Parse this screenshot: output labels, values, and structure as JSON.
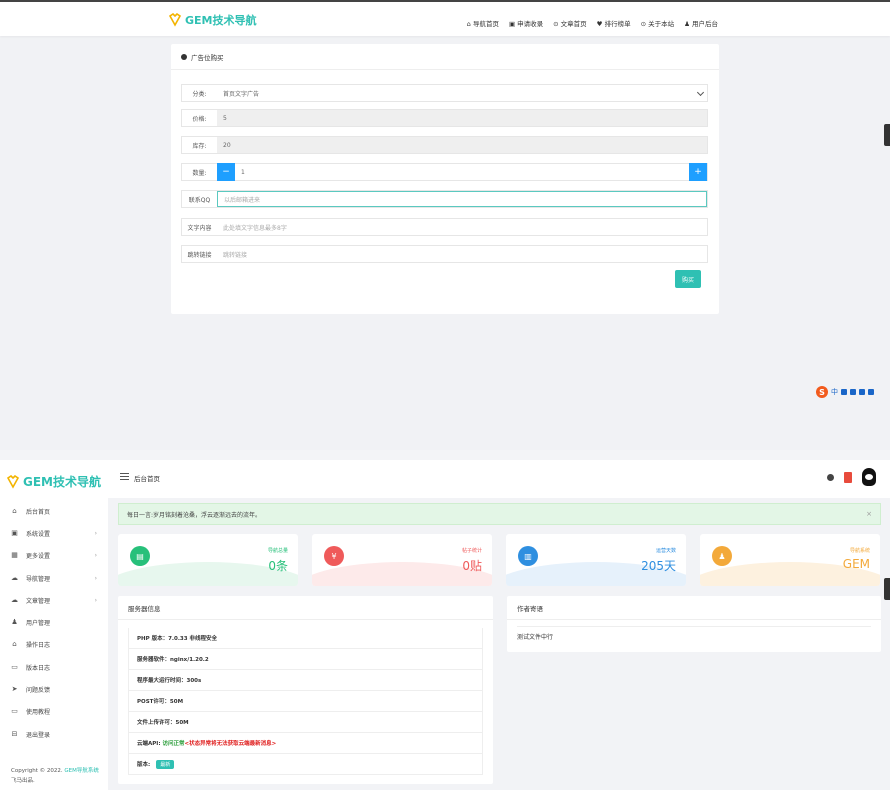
{
  "brand": {
    "name": "GEM技术导航",
    "accent": "#2fc0b3"
  },
  "top_nav": {
    "items": [
      {
        "icon": "home-icon",
        "label": "导航首页"
      },
      {
        "icon": "apply-icon",
        "label": "申请收录"
      },
      {
        "icon": "article-icon",
        "label": "文章首页"
      },
      {
        "icon": "rank-icon",
        "label": "排行榜单"
      },
      {
        "icon": "about-icon",
        "label": "关于本站"
      },
      {
        "icon": "user-icon",
        "label": "用户后台"
      }
    ]
  },
  "ad_form": {
    "title": "广告位购买",
    "category_label": "分类:",
    "category_value": "首页文字广告",
    "price_label": "价格:",
    "price_value": "5",
    "stock_label": "库存:",
    "stock_value": "20",
    "qty_label": "数量:",
    "qty_value": "1",
    "qty_minus": "−",
    "qty_plus": "+",
    "qq_label": "联系QQ",
    "qq_placeholder": "以后邮箱进来",
    "text_label": "文字内容",
    "text_placeholder": "此处填文字信息最多8字",
    "link_label": "跳转链接",
    "link_placeholder": "跳转链接",
    "buy_button": "购买"
  },
  "ime": {
    "logo": "S",
    "mode": "中"
  },
  "admin": {
    "header_title": "后台首页",
    "menu": [
      {
        "icon": "home-icon",
        "glyph": "⌂",
        "label": "后台首页",
        "arrow": ""
      },
      {
        "icon": "settings-icon",
        "glyph": "▣",
        "label": "系统设置",
        "arrow": "›"
      },
      {
        "icon": "grid-icon",
        "glyph": "▦",
        "label": "更多设置",
        "arrow": "›"
      },
      {
        "icon": "nav-icon",
        "glyph": "☁",
        "label": "导航管理",
        "arrow": "›"
      },
      {
        "icon": "cloud-icon",
        "glyph": "☁",
        "label": "文章管理",
        "arrow": "›"
      },
      {
        "icon": "user-icon",
        "glyph": "♟",
        "label": "用户管理",
        "arrow": ""
      },
      {
        "icon": "log-icon",
        "glyph": "⌂",
        "label": "操作日志",
        "arrow": ""
      },
      {
        "icon": "chat-icon",
        "glyph": "▭",
        "label": "版本日志",
        "arrow": ""
      },
      {
        "icon": "send-icon",
        "glyph": "➤",
        "label": "问题反馈",
        "arrow": ""
      },
      {
        "icon": "tutorial-icon",
        "glyph": "▭",
        "label": "使用教程",
        "arrow": ""
      },
      {
        "icon": "logout-icon",
        "glyph": "⊟",
        "label": "退出登录",
        "arrow": ""
      }
    ],
    "copyright_prefix": "Copyright © 2022.",
    "copyright_link": "GEM导航系统",
    "copyright_suffix": "飞马出品.",
    "notice": "每日一言:岁月铭刻着沧桑，浮云逐渐远去的流年。",
    "stats": [
      {
        "icon": "list-icon",
        "glyph": "▤",
        "label": "导航总量",
        "value": "0条",
        "color": "#27c07a",
        "bg": "#e7f7ee"
      },
      {
        "icon": "yen-icon",
        "glyph": "¥",
        "label": "帖子统计",
        "value": "0贴",
        "color": "#ef5a5a",
        "bg": "#fdeaea"
      },
      {
        "icon": "chart-icon",
        "glyph": "▥",
        "label": "运营天数",
        "value": "205天",
        "color": "#2f8fe0",
        "bg": "#e6f1fb"
      },
      {
        "icon": "person-icon",
        "glyph": "♟",
        "label": "导航系统",
        "value": "GEM",
        "color": "#f3a93a",
        "bg": "#fdf1df"
      }
    ],
    "server_panel": {
      "title": "服务器信息",
      "rows": [
        "PHP 版本：7.0.33 非线程安全",
        "服务器软件：nginx/1.20.2",
        "程序最大运行时间：300s",
        "POST许可：50M",
        "文件上传许可：50M"
      ],
      "cloud_label": "云端API:",
      "cloud_status": "访问正常",
      "cloud_msg": "<状态异常将无法获取云端最新消息>",
      "version_label": "版本:",
      "version_badge": "最新"
    },
    "author_panel": {
      "title": "作者寄语",
      "body": "测试文件中行"
    }
  }
}
